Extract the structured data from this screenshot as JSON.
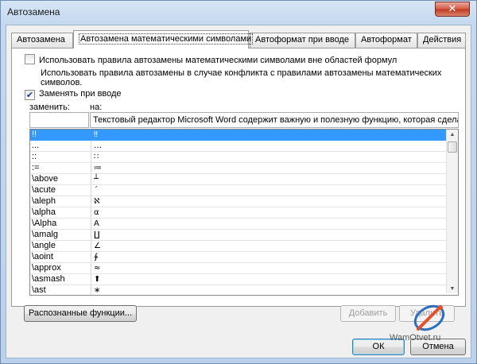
{
  "window": {
    "title": "Автозамена"
  },
  "tabs": [
    {
      "label": "Автозамена"
    },
    {
      "label": "Автозамена математическими символами"
    },
    {
      "label": "Автоформат при вводе"
    },
    {
      "label": "Автоформат"
    },
    {
      "label": "Действия"
    }
  ],
  "panel": {
    "use_outside_label": "Использовать правила автозамены математическими символами вне областей формул",
    "conflict_note_line1": "Использовать правила автозамены в случае конфликта с правилами автозамены математических",
    "conflict_note_line2": "символов.",
    "replace_as_type_label": "Заменять при вводе",
    "replace_as_type_checked": true,
    "replace_header": "заменить:",
    "with_header": "на:",
    "replace_value": "",
    "with_value": "Текстовый редактор Microsoft Word содержит важную и полезную функцию, которая сделает",
    "rows": [
      {
        "name": "!!",
        "value": "‼"
      },
      {
        "name": "...",
        "value": "…"
      },
      {
        "name": "::",
        "value": "∷"
      },
      {
        "name": ":=",
        "value": "≔"
      },
      {
        "name": "\\above",
        "value": "┴"
      },
      {
        "name": "\\acute",
        "value": "ˊ"
      },
      {
        "name": "\\aleph",
        "value": "ℵ"
      },
      {
        "name": "\\alpha",
        "value": "α"
      },
      {
        "name": "\\Alpha",
        "value": "Α"
      },
      {
        "name": "\\amalg",
        "value": "∐"
      },
      {
        "name": "\\angle",
        "value": "∠"
      },
      {
        "name": "\\aoint",
        "value": "∳"
      },
      {
        "name": "\\approx",
        "value": "≈"
      },
      {
        "name": "\\asmash",
        "value": "⬆"
      },
      {
        "name": "\\ast",
        "value": "∗"
      }
    ]
  },
  "buttons": {
    "recognized": "Распознанные функции...",
    "add": "Добавить",
    "delete": "Удалить",
    "ok": "ОК",
    "cancel": "Отмена"
  },
  "watermark": {
    "text": "WamOtvet.ru"
  }
}
